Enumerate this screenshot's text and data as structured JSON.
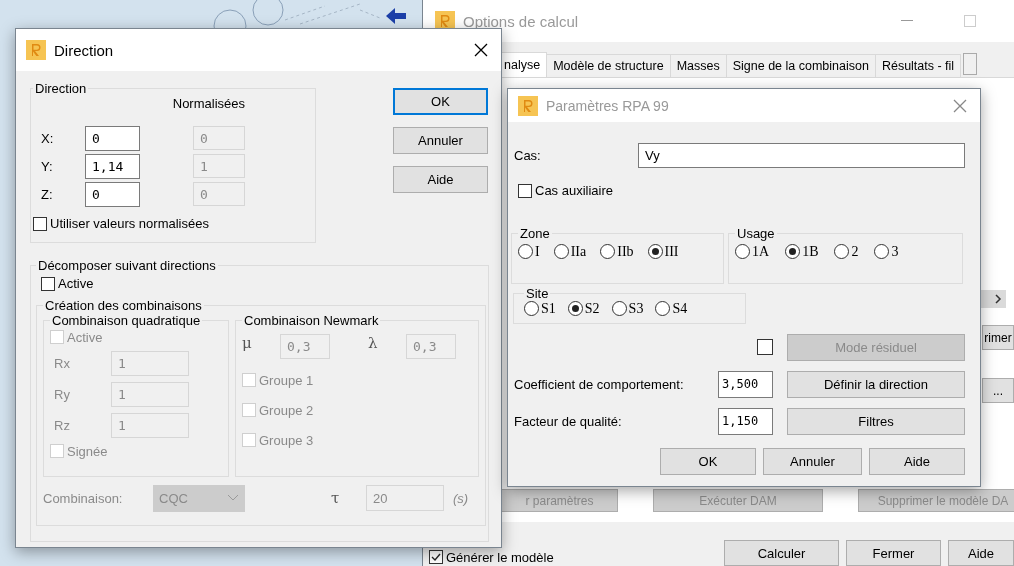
{
  "options_window": {
    "title": "Options de calcul",
    "tabs": [
      {
        "label": "nalyse",
        "selected": true
      },
      {
        "label": "Modèle de structure",
        "selected": false
      },
      {
        "label": "Masses",
        "selected": false
      },
      {
        "label": "Signe de la combinaison",
        "selected": false
      },
      {
        "label": "Résultats - fil",
        "selected": false
      }
    ],
    "side_buttons": [
      "rimer",
      "..."
    ],
    "panel_buttons": [
      {
        "label": "r paramètres",
        "disabled": true
      },
      {
        "label": "Exécuter DAM",
        "disabled": true
      },
      {
        "label": "Supprimer le modèle DA",
        "disabled": true
      }
    ],
    "generate_model": {
      "label": "Générer le modèle",
      "checked": true
    },
    "actions": [
      "Calculer",
      "Fermer",
      "Aide"
    ]
  },
  "direction_dialog": {
    "title": "Direction",
    "direction_group": {
      "title": "Direction",
      "normalized_header": "Normalisées",
      "rows": [
        {
          "label": "X:",
          "value": "0",
          "normalized": "0"
        },
        {
          "label": "Y:",
          "value": "1,14",
          "normalized": "1"
        },
        {
          "label": "Z:",
          "value": "0",
          "normalized": "0"
        }
      ],
      "use_normalized": {
        "label": "Utiliser valeurs normalisées",
        "checked": false
      }
    },
    "buttons": [
      {
        "label": "OK",
        "focused": true
      },
      {
        "label": "Annuler",
        "focused": false
      },
      {
        "label": "Aide",
        "focused": false
      }
    ],
    "decompose": {
      "title": "Décomposer suivant directions",
      "active": {
        "label": "Active",
        "checked": false
      },
      "combinations": {
        "title": "Création des combinaisons",
        "disabled": true,
        "quadratic": {
          "title": "Combinaison quadratique",
          "active": {
            "label": "Active",
            "checked": false
          },
          "rows": [
            {
              "label": "Rx",
              "value": "1"
            },
            {
              "label": "Ry",
              "value": "1"
            },
            {
              "label": "Rz",
              "value": "1"
            }
          ],
          "signed": {
            "label": "Signée",
            "checked": false
          }
        },
        "newmark": {
          "title": "Combinaison Newmark",
          "params": [
            {
              "symbol": "μ",
              "value": "0,3"
            },
            {
              "symbol": "λ",
              "value": "0,3"
            }
          ],
          "groups": [
            {
              "label": "Groupe 1",
              "checked": false
            },
            {
              "label": "Groupe 2",
              "checked": false
            },
            {
              "label": "Groupe 3",
              "checked": false
            }
          ]
        },
        "combination": {
          "label": "Combinaison:",
          "value": "CQC"
        },
        "tau": {
          "symbol": "τ",
          "value": "20",
          "unit": "(s)"
        }
      }
    }
  },
  "rpa_dialog": {
    "title": "Paramètres RPA 99",
    "case": {
      "label": "Cas:",
      "value": "Vy"
    },
    "auxiliary": {
      "label": "Cas auxiliaire",
      "checked": false
    },
    "zone": {
      "title": "Zone",
      "options": [
        {
          "label": "I",
          "selected": false
        },
        {
          "label": "IIa",
          "selected": false
        },
        {
          "label": "IIb",
          "selected": false
        },
        {
          "label": "III",
          "selected": true
        }
      ]
    },
    "usage": {
      "title": "Usage",
      "options": [
        {
          "label": "1A",
          "selected": false
        },
        {
          "label": "1B",
          "selected": true
        },
        {
          "label": "2",
          "selected": false
        },
        {
          "label": "3",
          "selected": false
        }
      ]
    },
    "site": {
      "title": "Site",
      "options": [
        {
          "label": "S1",
          "selected": false
        },
        {
          "label": "S2",
          "selected": true
        },
        {
          "label": "S3",
          "selected": false
        },
        {
          "label": "S4",
          "selected": false
        }
      ]
    },
    "residual": {
      "checked": false,
      "label": "Mode résiduel",
      "disabled": true
    },
    "behavior": {
      "label": "Coefficient de comportement:",
      "value": "3,500",
      "button": "Définir la direction"
    },
    "quality": {
      "label": "Facteur de qualité:",
      "value": "1,150",
      "button": "Filtres"
    },
    "buttons": [
      "OK",
      "Annuler",
      "Aide"
    ]
  }
}
